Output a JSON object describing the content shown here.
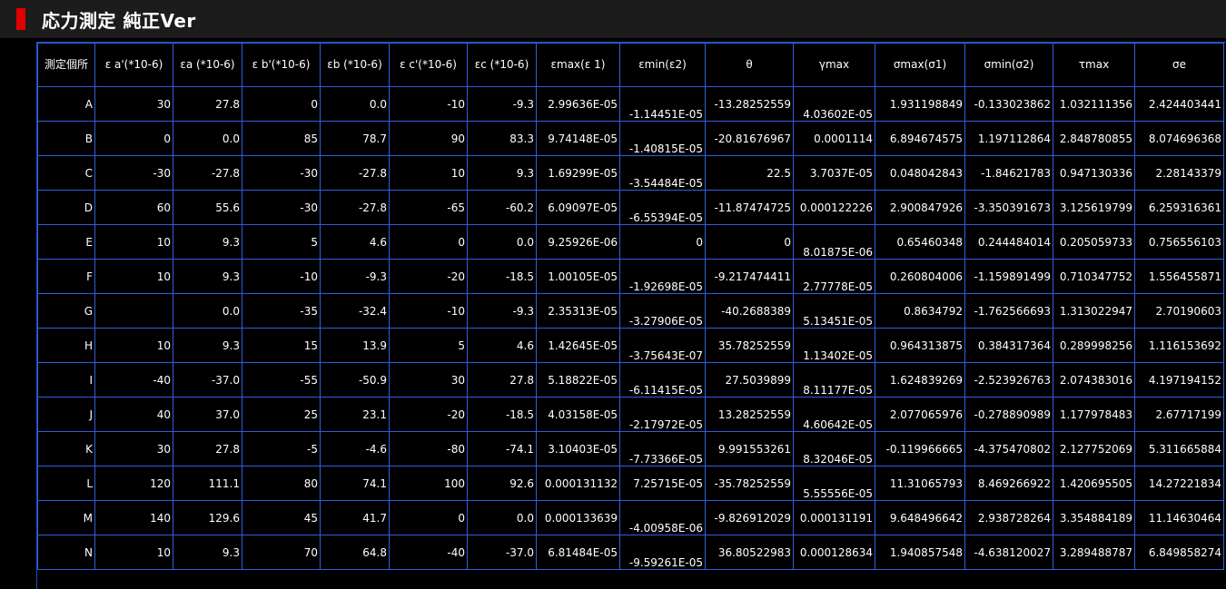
{
  "title": "応力測定 純正Ver",
  "headers": [
    "測定個所",
    "ε a'(*10-6)",
    "εa (*10-6)",
    "ε b'(*10-6)",
    "εb (*10-6)",
    "ε c'(*10-6)",
    "εc (*10-6)",
    "εmax(ε 1)",
    "εmin(ε2)",
    "θ",
    "γmax",
    "σmax(σ1)",
    "σmin(σ2)",
    "τmax",
    "σe"
  ],
  "rows": [
    [
      "A",
      "30",
      "27.8",
      "0",
      "0.0",
      "-10",
      "-9.3",
      "2.99636E-05",
      "-1.14451E-05",
      "-13.28252559",
      "4.03602E-05",
      "1.931198849",
      "-0.133023862",
      "1.032111356",
      "2.424403441"
    ],
    [
      "B",
      "0",
      "0.0",
      "85",
      "78.7",
      "90",
      "83.3",
      "9.74148E-05",
      "-1.40815E-05",
      "-20.81676967",
      "0.0001114",
      "6.894674575",
      "1.197112864",
      "2.848780855",
      "8.074696368"
    ],
    [
      "C",
      "-30",
      "-27.8",
      "-30",
      "-27.8",
      "10",
      "9.3",
      "1.69299E-05",
      "-3.54484E-05",
      "22.5",
      "3.7037E-05",
      "0.048042843",
      "-1.84621783",
      "0.947130336",
      "2.28143379"
    ],
    [
      "D",
      "60",
      "55.6",
      "-30",
      "-27.8",
      "-65",
      "-60.2",
      "6.09097E-05",
      "-6.55394E-05",
      "-11.87474725",
      "0.000122226",
      "2.900847926",
      "-3.350391673",
      "3.125619799",
      "6.259316361"
    ],
    [
      "E",
      "10",
      "9.3",
      "5",
      "4.6",
      "0",
      "0.0",
      "9.25926E-06",
      "0",
      "0",
      "8.01875E-06",
      "0.65460348",
      "0.244484014",
      "0.205059733",
      "0.756556103"
    ],
    [
      "F",
      "10",
      "9.3",
      "-10",
      "-9.3",
      "-20",
      "-18.5",
      "1.00105E-05",
      "-1.92698E-05",
      "-9.217474411",
      "2.77778E-05",
      "0.260804006",
      "-1.159891499",
      "0.710347752",
      "1.556455871"
    ],
    [
      "G",
      "",
      "0.0",
      "-35",
      "-32.4",
      "-10",
      "-9.3",
      "2.35313E-05",
      "-3.27906E-05",
      "-40.2688389",
      "5.13451E-05",
      "0.8634792",
      "-1.762566693",
      "1.313022947",
      "2.70190603"
    ],
    [
      "H",
      "10",
      "9.3",
      "15",
      "13.9",
      "5",
      "4.6",
      "1.42645E-05",
      "-3.75643E-07",
      "35.78252559",
      "1.13402E-05",
      "0.964313875",
      "0.384317364",
      "0.289998256",
      "1.116153692"
    ],
    [
      "I",
      "-40",
      "-37.0",
      "-55",
      "-50.9",
      "30",
      "27.8",
      "5.18822E-05",
      "-6.11415E-05",
      "27.5039899",
      "8.11177E-05",
      "1.624839269",
      "-2.523926763",
      "2.074383016",
      "4.197194152"
    ],
    [
      "J",
      "40",
      "37.0",
      "25",
      "23.1",
      "-20",
      "-18.5",
      "4.03158E-05",
      "-2.17972E-05",
      "13.28252559",
      "4.60642E-05",
      "2.077065976",
      "-0.278890989",
      "1.177978483",
      "2.67717199"
    ],
    [
      "K",
      "30",
      "27.8",
      "-5",
      "-4.6",
      "-80",
      "-74.1",
      "3.10403E-05",
      "-7.73366E-05",
      "9.991553261",
      "8.32046E-05",
      "-0.119966665",
      "-4.375470802",
      "2.127752069",
      "5.311665884"
    ],
    [
      "L",
      "120",
      "111.1",
      "80",
      "74.1",
      "100",
      "92.6",
      "0.000131132",
      "7.25715E-05",
      "-35.78252559",
      "5.55556E-05",
      "11.31065793",
      "8.469266922",
      "1.420695505",
      "14.27221834"
    ],
    [
      "M",
      "140",
      "129.6",
      "45",
      "41.7",
      "0",
      "0.0",
      "0.000133639",
      "-4.00958E-06",
      "-9.826912029",
      "0.000131191",
      "9.648496642",
      "2.938728264",
      "3.354884189",
      "11.14630464"
    ],
    [
      "N",
      "10",
      "9.3",
      "70",
      "64.8",
      "-40",
      "-37.0",
      "6.81484E-05",
      "-9.59261E-05",
      "36.80522983",
      "0.000128634",
      "1.940857548",
      "-4.638120027",
      "3.289488787",
      "6.849858274"
    ]
  ]
}
